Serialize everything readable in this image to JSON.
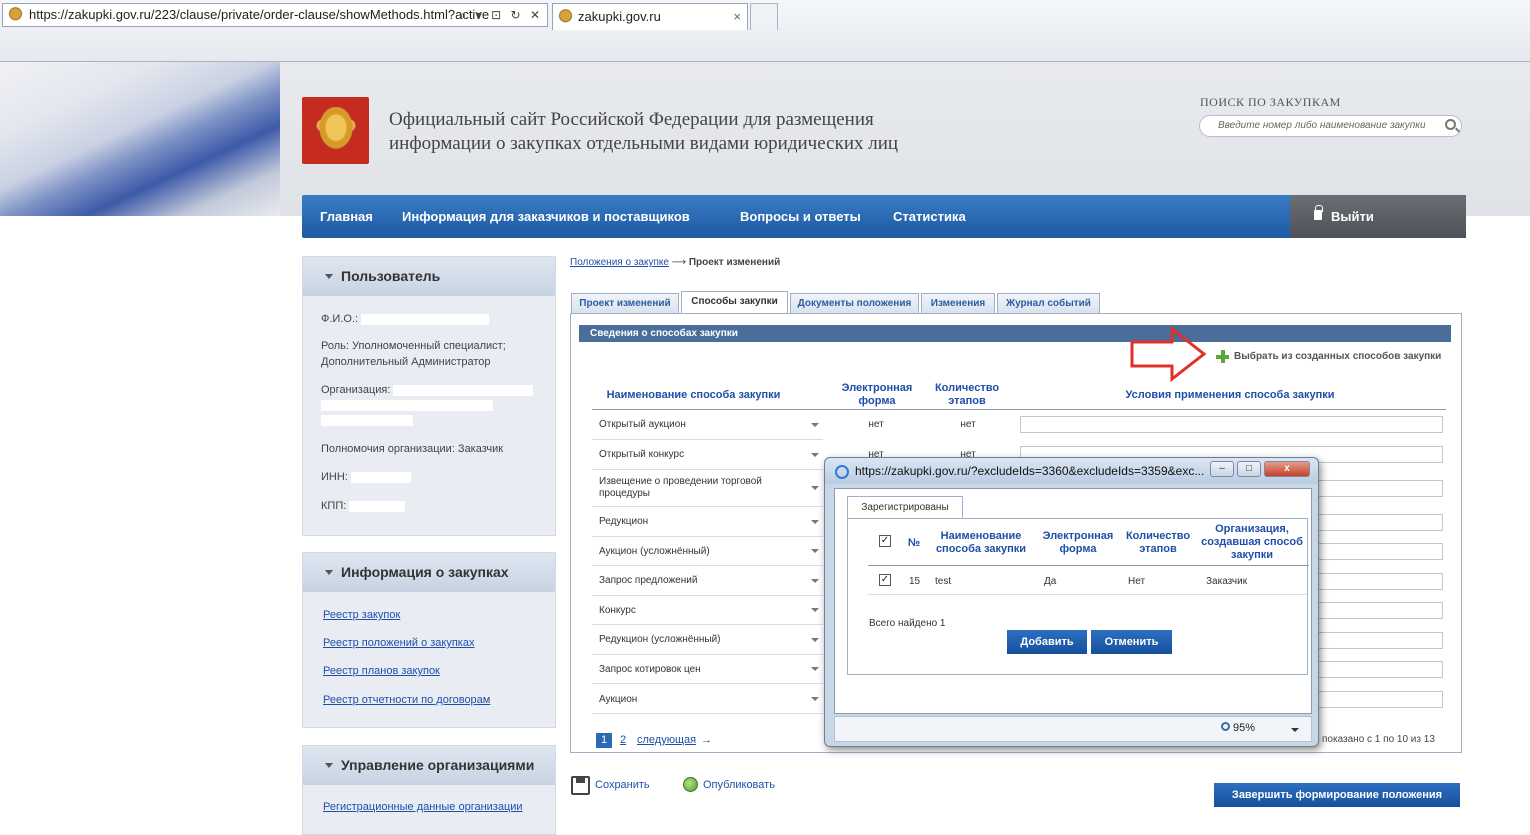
{
  "browser": {
    "address": "https://zakupki.gov.ru/223/clause/private/order-clause/showMethods.html?active",
    "tab_title": "zakupki.gov.ru",
    "tab_close": "×"
  },
  "header": {
    "site_title_line1": "Официальный сайт Российской Федерации для размещения",
    "site_title_line2": "информации о закупках отдельными видами юридических лиц",
    "search_label": "ПОИСК ПО ЗАКУПКАМ",
    "search_placeholder": "Введите номер либо наименование закупки"
  },
  "nav": {
    "items": [
      "Главная",
      "Информация для заказчиков и поставщиков",
      "Вопросы и ответы",
      "Статистика"
    ],
    "logout": "Выйти"
  },
  "sidebar": {
    "user": {
      "title": "Пользователь",
      "fio_label": "Ф.И.О.:",
      "role_line1": "Роль: Уполномоченный специалист;",
      "role_line2": "Дополнительный Администратор",
      "org_label": "Организация:",
      "powers": "Полномочия организации: Заказчик",
      "inn_label": "ИНН:",
      "kpp_label": "КПП:"
    },
    "info": {
      "title": "Информация о закупках",
      "links": [
        "Реестр закупок",
        "Реестр положений о закупках",
        "Реестр планов закупок",
        "Реестр отчетности по договорам"
      ]
    },
    "manage": {
      "title": "Управление организациями",
      "links": [
        "Регистрационные данные организации"
      ]
    }
  },
  "main": {
    "breadcrumb_link": "Положения о закупке",
    "breadcrumb_arrow": "⟶",
    "breadcrumb_current": "Проект изменений",
    "tabs": [
      "Проект изменений",
      "Способы закупки",
      "Документы положения",
      "Изменения",
      "Журнал событий"
    ],
    "active_tab": "Способы закупки",
    "section_title": "Сведения о способах закупки",
    "choose_link": "Выбрать из созданных способов закупки",
    "columns": {
      "name": "Наименование способа закупки",
      "eform": "Электронная форма",
      "stages": "Количество этапов",
      "conditions": "Условия применения способа закупки"
    },
    "rows": [
      {
        "name": "Открытый аукцион",
        "eform": "нет",
        "stages": "нет"
      },
      {
        "name": "Открытый конкурс",
        "eform": "нет",
        "stages": "нет"
      },
      {
        "name": "Извещение о проведении торговой процедуры",
        "eform": "",
        "stages": ""
      },
      {
        "name": "Редукцион",
        "eform": "",
        "stages": ""
      },
      {
        "name": "Аукцион (усложнённый)",
        "eform": "",
        "stages": ""
      },
      {
        "name": "Запрос предложений",
        "eform": "",
        "stages": ""
      },
      {
        "name": "Конкурс",
        "eform": "",
        "stages": ""
      },
      {
        "name": "Редукцион (усложнённый)",
        "eform": "",
        "stages": ""
      },
      {
        "name": "Запрос котировок цен",
        "eform": "",
        "stages": ""
      },
      {
        "name": "Аукцион",
        "eform": "",
        "stages": ""
      }
    ],
    "pager": {
      "current": "1",
      "page2": "2",
      "next": "следующая",
      "next_arrow": "→"
    },
    "shown_text": "показано с 1 по 10 из 13",
    "save": "Сохранить",
    "publish": "Опубликовать",
    "finish": "Завершить формирование положения"
  },
  "popup": {
    "url": "https://zakupki.gov.ru/?excludeIds=3360&excludeIds=3359&exc...",
    "min": "‒",
    "max": "□",
    "close": "x",
    "tab": "Зарегистрированы",
    "columns": {
      "num": "№",
      "name": "Наименование способа закупки",
      "eform": "Электронная форма",
      "stages": "Количество этапов",
      "org": "Организация, создавшая способ закупки"
    },
    "row": {
      "num": "15",
      "name": "test",
      "eform": "Да",
      "stages": "Нет",
      "org": "Заказчик"
    },
    "check": "✓",
    "total": "Всего найдено 1",
    "add": "Добавить",
    "cancel": "Отменить",
    "zoom": "95%"
  }
}
